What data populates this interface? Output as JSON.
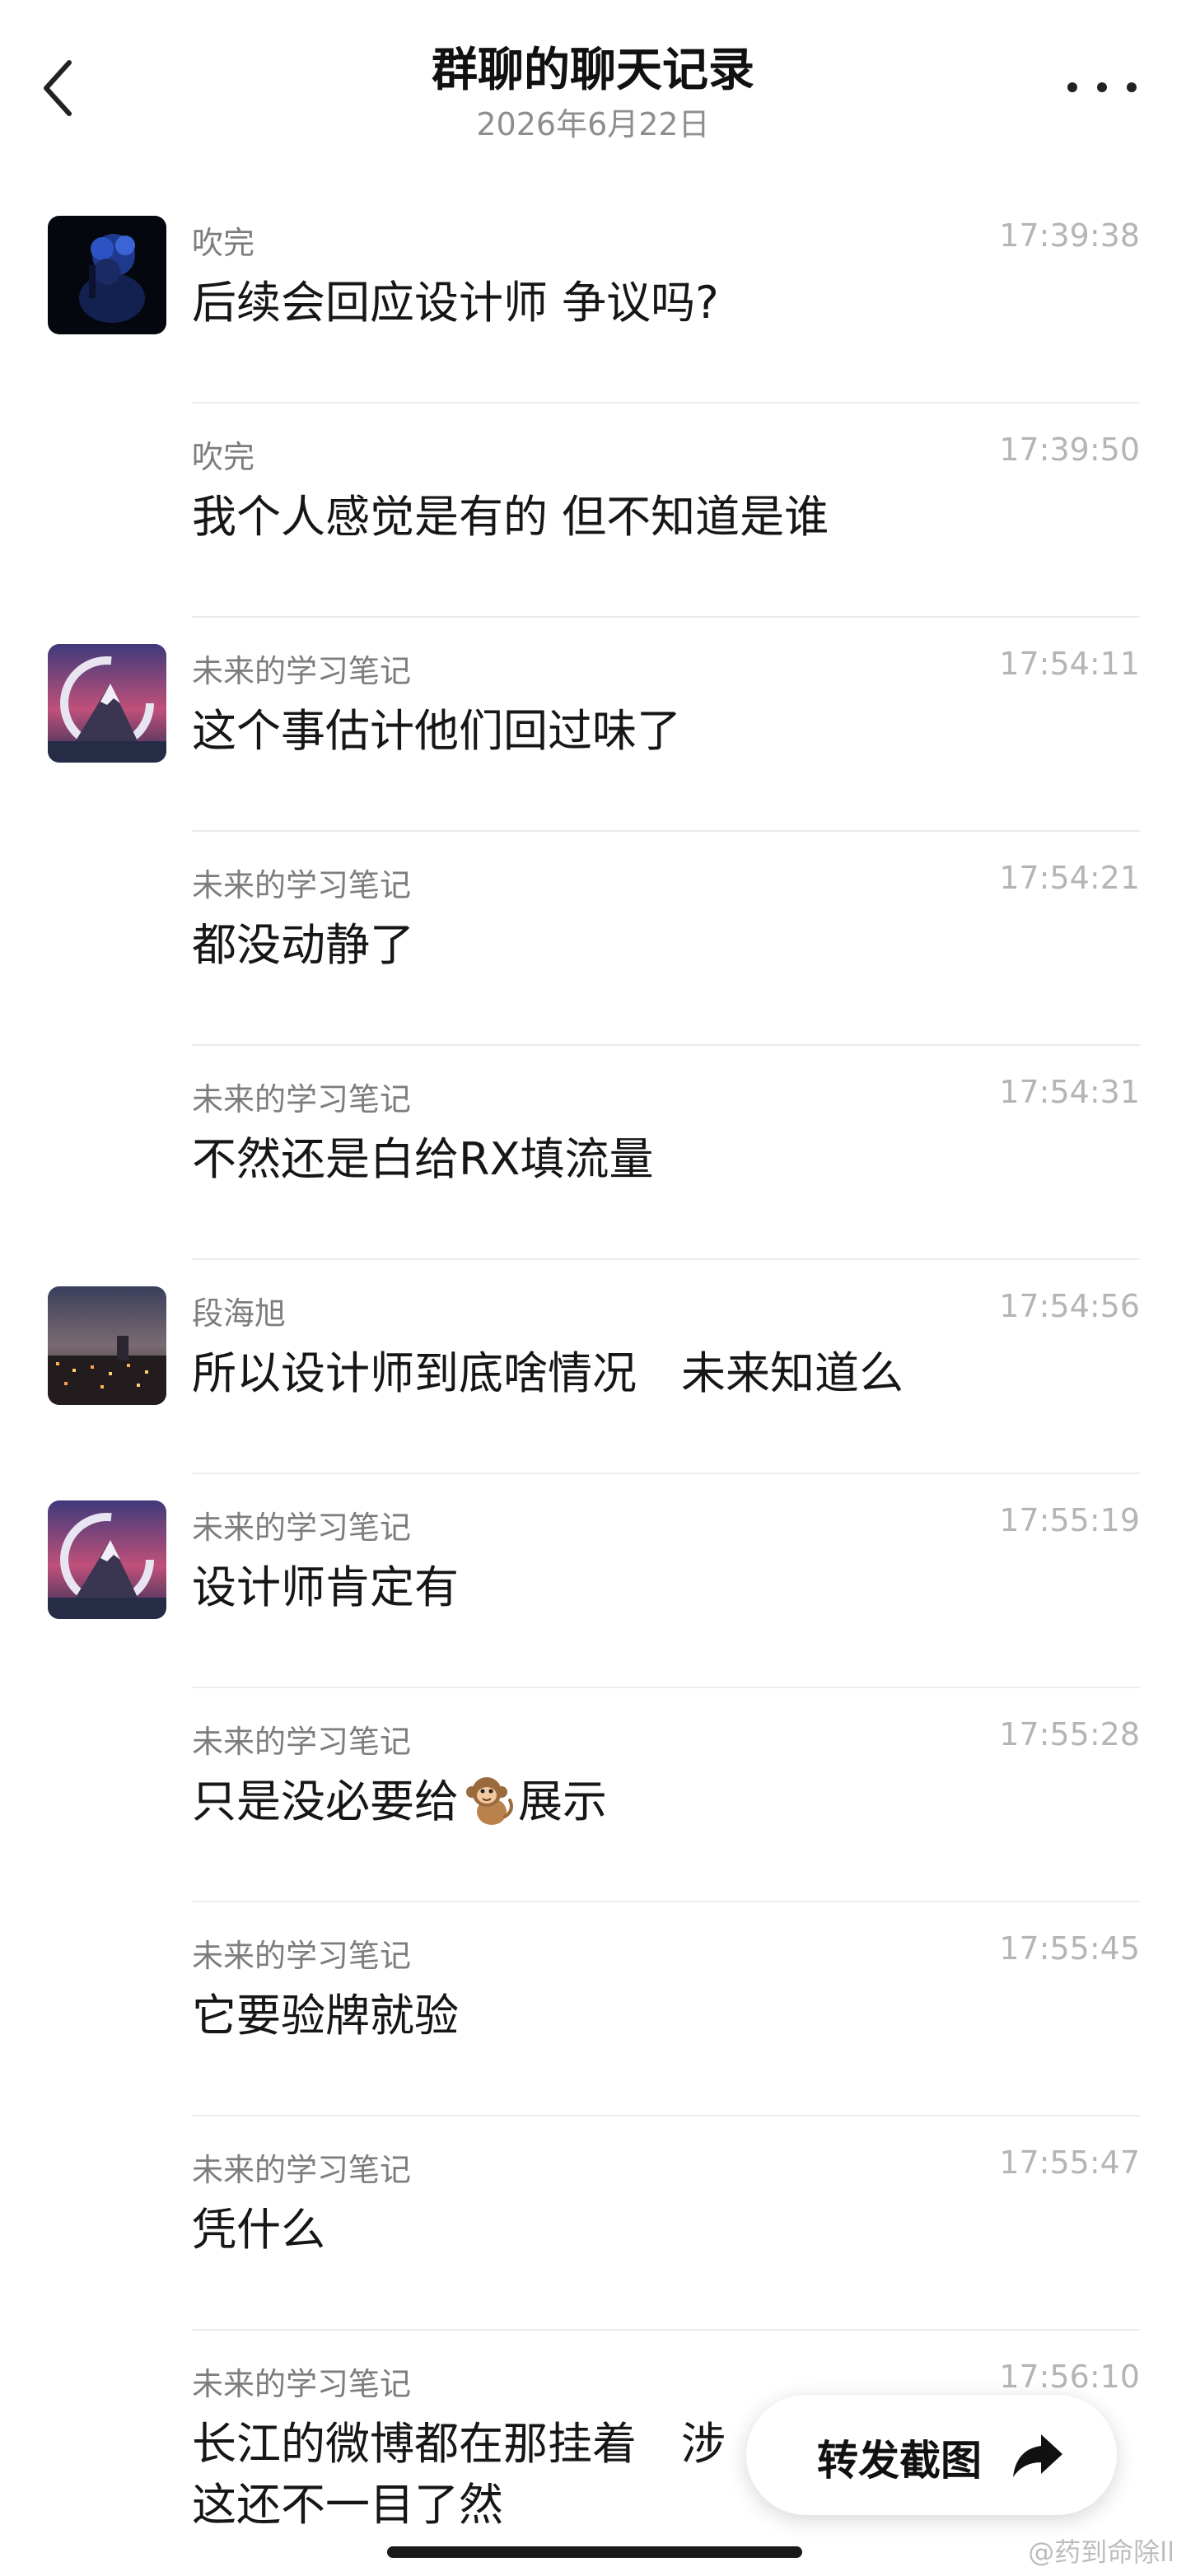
{
  "header": {
    "title": "群聊的聊天记录",
    "date": "2026年6月22日"
  },
  "messages": [
    {
      "sender": "吹完",
      "time": "17:39:38",
      "text": "后续会回应设计师 争议吗?",
      "avatar": "night-portrait-avatar"
    },
    {
      "sender": "吹完",
      "time": "17:39:50",
      "text": "我个人感觉是有的 但不知道是谁"
    },
    {
      "sender": "未来的学习笔记",
      "time": "17:54:11",
      "text": "这个事估计他们回过味了",
      "avatar": "mountain-avatar"
    },
    {
      "sender": "未来的学习笔记",
      "time": "17:54:21",
      "text": "都没动静了"
    },
    {
      "sender": "未来的学习笔记",
      "time": "17:54:31",
      "text": "不然还是白给RX填流量"
    },
    {
      "sender": "段海旭",
      "time": "17:54:56",
      "text": "所以设计师到底啥情况　未来知道么",
      "avatar": "city-night-avatar"
    },
    {
      "sender": "未来的学习笔记",
      "time": "17:55:19",
      "text": "设计师肯定有",
      "avatar": "mountain-avatar"
    },
    {
      "sender": "未来的学习笔记",
      "time": "17:55:28",
      "text_before": "只是没必要给",
      "emoji": "monkey-emoji",
      "text_after": "展示"
    },
    {
      "sender": "未来的学习笔记",
      "time": "17:55:45",
      "text": "它要验牌就验"
    },
    {
      "sender": "未来的学习笔记",
      "time": "17:55:47",
      "text": "凭什么"
    },
    {
      "sender": "未来的学习笔记",
      "time": "17:56:10",
      "text": "长江的微博都在那挂着　涉",
      "text2": "这还不一目了然"
    }
  ],
  "forward_button": {
    "label": "转发截图",
    "icon": "share-arrow-icon"
  },
  "watermark": "@药到命除ll",
  "icons": {
    "back": "chevron-left-icon",
    "more": "more-dots-icon"
  }
}
